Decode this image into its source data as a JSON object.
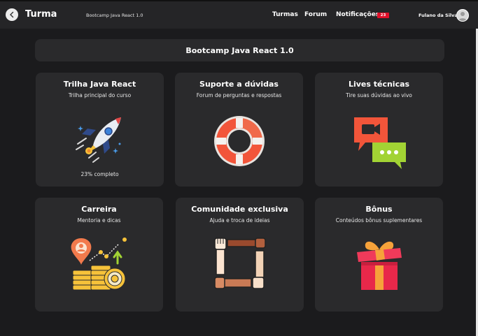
{
  "header": {
    "title": "Turma",
    "course": "Bootcamp Java React 1.0",
    "nav": [
      "Turmas",
      "Forum",
      "Notificações"
    ],
    "notification_count": "23",
    "user_name": "Fulano da Silva"
  },
  "banner": {
    "title": "Bootcamp Java React 1.0"
  },
  "cards": [
    {
      "title": "Trilha Java React",
      "subtitle": "Trilha principal do curso",
      "progress": "23% completo",
      "icon": "rocket-icon"
    },
    {
      "title": "Suporte a dúvidas",
      "subtitle": "Forum de perguntas e respostas",
      "icon": "lifebuoy-icon"
    },
    {
      "title": "Lives técnicas",
      "subtitle": "Tire suas dúvidas ao vivo",
      "icon": "video-chat-icon"
    },
    {
      "title": "Carreira",
      "subtitle": "Mentoria e dicas",
      "icon": "career-growth-icon"
    },
    {
      "title": "Comunidade exclusiva",
      "subtitle": "Ajuda e troca de ideias",
      "icon": "community-hands-icon"
    },
    {
      "title": "Bônus",
      "subtitle": "Conteúdos bônus suplementares",
      "icon": "gift-icon"
    }
  ],
  "colors": {
    "background": "#1b1b1d",
    "card": "#2a2a2c",
    "topbar": "#252527",
    "badge": "#e0102a"
  }
}
